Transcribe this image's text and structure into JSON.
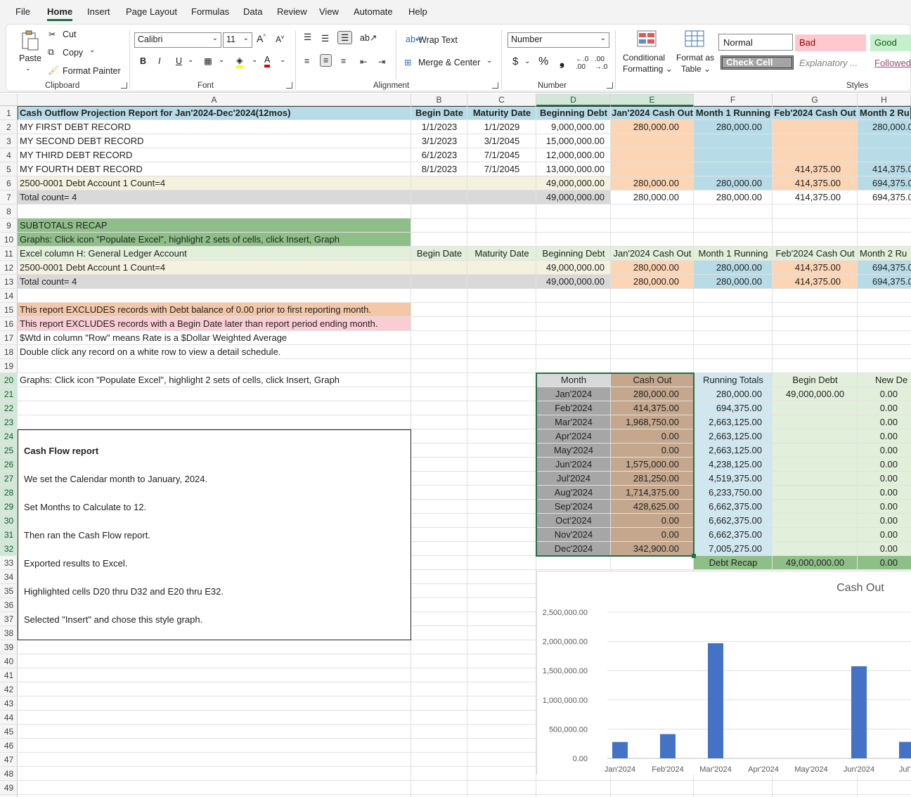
{
  "menu": [
    "File",
    "Home",
    "Insert",
    "Page Layout",
    "Formulas",
    "Data",
    "Review",
    "View",
    "Automate",
    "Help"
  ],
  "ribbon": {
    "clipboard": {
      "paste": "Paste",
      "cut": "Cut",
      "copy": "Copy",
      "format_painter": "Format Painter",
      "label": "Clipboard"
    },
    "font": {
      "name": "Calibri",
      "size": "11",
      "label": "Font",
      "bold": "B",
      "italic": "I",
      "underline": "U"
    },
    "alignment": {
      "wrap": "Wrap Text",
      "merge": "Merge & Center",
      "label": "Alignment"
    },
    "number": {
      "format": "Number",
      "currency": "$",
      "percent": "%",
      "comma": "❟",
      "label": "Number"
    },
    "styles": {
      "conditional": "Conditional",
      "conditional2": "Formatting",
      "format_as": "Format as",
      "format_as2": "Table",
      "normal": "Normal",
      "bad": "Bad",
      "good": "Good",
      "check_cell": "Check Cell",
      "explanatory": "Explanatory ...",
      "followed": "Followed",
      "label": "Styles"
    }
  },
  "columns": [
    "A",
    "B",
    "C",
    "D",
    "E",
    "F",
    "G",
    "H"
  ],
  "rows": [
    "1",
    "2",
    "3",
    "4",
    "5",
    "6",
    "7",
    "8",
    "9",
    "10",
    "11",
    "12",
    "13",
    "14",
    "15",
    "16",
    "17",
    "18",
    "19",
    "20",
    "21",
    "22",
    "23",
    "24",
    "25",
    "26",
    "27",
    "28",
    "29",
    "30",
    "31",
    "32",
    "33",
    "34",
    "35",
    "36",
    "37",
    "38",
    "39",
    "40",
    "41",
    "42",
    "43",
    "44",
    "45",
    "46",
    "47",
    "48",
    "49"
  ],
  "header": {
    "a": "Cash Outflow Projection Report for Jan'2024-Dec'2024(12mos)",
    "b": "Begin Date",
    "c": "Maturity Date",
    "d": "Beginning Debt",
    "e": "Jan'2024 Cash Out",
    "f": "Month 1 Running",
    "g": "Feb'2024 Cash Out",
    "h": "Month 2 Ru"
  },
  "records": [
    {
      "name": "MY FIRST DEBT RECORD",
      "begin": "1/1/2023",
      "maturity": "1/1/2029",
      "debt": "9,000,000.00",
      "e": "280,000.00",
      "f": "280,000.00",
      "g": "",
      "h": "280,000.0"
    },
    {
      "name": "MY SECOND DEBT RECORD",
      "begin": "3/1/2023",
      "maturity": "3/1/2045",
      "debt": "15,000,000.00",
      "e": "",
      "f": "",
      "g": "",
      "h": ""
    },
    {
      "name": "MY THIRD DEBT RECORD",
      "begin": "6/1/2023",
      "maturity": "7/1/2045",
      "debt": "12,000,000.00",
      "e": "",
      "f": "",
      "g": "",
      "h": ""
    },
    {
      "name": "MY FOURTH DEBT RECORD",
      "begin": "8/1/2023",
      "maturity": "7/1/2045",
      "debt": "13,000,000.00",
      "e": "",
      "f": "",
      "g": "414,375.00",
      "h": "414,375.0"
    }
  ],
  "account_row": {
    "name": "2500-0001 Debt Account 1 Count=4",
    "debt": "49,000,000.00",
    "e": "280,000.00",
    "f": "280,000.00",
    "g": "414,375.00",
    "h": "694,375.0"
  },
  "total_row": {
    "name": "Total count= 4",
    "debt": "49,000,000.00",
    "e": "280,000.00",
    "f": "280,000.00",
    "g": "414,375.00",
    "h": "694,375.0"
  },
  "recap": {
    "title": "SUBTOTALS RECAP",
    "graphs": "Graphs: Click icon \"Populate Excel\", highlight 2 sets of cells, click Insert, Graph",
    "gl": "Excel column H: General Ledger Account",
    "b": "Begin Date",
    "c": "Maturity Date",
    "d": "Beginning Debt",
    "e": "Jan'2024 Cash Out",
    "f": "Month 1 Running",
    "g": "Feb'2024 Cash Out",
    "h": "Month 2 Ru"
  },
  "notes": {
    "n15": "This report EXCLUDES records with Debt balance of 0.00 prior to first reporting month.",
    "n16": "This report EXCLUDES records with a Begin Date later than report period ending month.",
    "n17": "$Wtd in column \"Row\" means Rate is a $Dollar Weighted Average",
    "n18": "Double click any record on a white row to view a detail schedule.",
    "n20": "Graphs: Click icon \"Populate Excel\", highlight 2 sets of cells, click Insert, Graph"
  },
  "monthly": {
    "headers": {
      "month": "Month",
      "cash": "Cash Out",
      "running": "Running Totals",
      "begin": "Begin Debt",
      "new": "New De"
    },
    "begin_debt": "49,000,000.00",
    "rows": [
      {
        "m": "Jan'2024",
        "c": "280,000.00",
        "r": "280,000.00",
        "n": "0.00"
      },
      {
        "m": "Feb'2024",
        "c": "414,375.00",
        "r": "694,375.00",
        "n": "0.00"
      },
      {
        "m": "Mar'2024",
        "c": "1,968,750.00",
        "r": "2,663,125.00",
        "n": "0.00"
      },
      {
        "m": "Apr'2024",
        "c": "0.00",
        "r": "2,663,125.00",
        "n": "0.00"
      },
      {
        "m": "May'2024",
        "c": "0.00",
        "r": "2,663,125.00",
        "n": "0.00"
      },
      {
        "m": "Jun'2024",
        "c": "1,575,000.00",
        "r": "4,238,125.00",
        "n": "0.00"
      },
      {
        "m": "Jul'2024",
        "c": "281,250.00",
        "r": "4,519,375.00",
        "n": "0.00"
      },
      {
        "m": "Aug'2024",
        "c": "1,714,375.00",
        "r": "6,233,750.00",
        "n": "0.00"
      },
      {
        "m": "Sep'2024",
        "c": "428,625.00",
        "r": "6,662,375.00",
        "n": "0.00"
      },
      {
        "m": "Oct'2024",
        "c": "0.00",
        "r": "6,662,375.00",
        "n": "0.00"
      },
      {
        "m": "Nov'2024",
        "c": "0.00",
        "r": "6,662,375.00",
        "n": "0.00"
      },
      {
        "m": "Dec'2024",
        "c": "342,900.00",
        "r": "7,005,275.00",
        "n": "0.00"
      }
    ],
    "recap_label": "Debt Recap",
    "recap_value": "49,000,000.00",
    "recap_new": "0.00"
  },
  "notebox": {
    "title": "Cash Flow report",
    "l1": "We set the Calendar month to January, 2024.",
    "l2": "Set Months to Calculate to 12.",
    "l3": "Then ran the Cash Flow report.",
    "l4": "Exported results to Excel.",
    "l5": "Highlighted cells D20 thru D32 and E20 thru E32.",
    "l6": "Selected \"Insert\" and chose this style graph."
  },
  "colors": {
    "blue_fill": "#b7dce8",
    "peach_fill": "#fcd5b4",
    "cream_fill": "#f4f1df",
    "gray_fill": "#d9d9d9",
    "green_fill": "#8fbf88",
    "light_green": "#e2efda",
    "pink_fill": "#f9cdd3",
    "orange_fill": "#f4c7a6",
    "month_gray": "#a6a6a6",
    "cash_tan": "#c4a78d",
    "bar": "#4472c4"
  },
  "chart_data": {
    "type": "bar",
    "title": "Cash Out",
    "categories": [
      "Jan'2024",
      "Feb'2024",
      "Mar'2024",
      "Apr'2024",
      "May'2024",
      "Jun'2024",
      "Jul'2"
    ],
    "values": [
      280000,
      414375,
      1968750,
      0,
      0,
      1575000,
      281250
    ],
    "ylim": [
      0,
      2500000
    ],
    "yticks": [
      "0.00",
      "500,000.00",
      "1,000,000.00",
      "1,500,000.00",
      "2,000,000.00",
      "2,500,000.00"
    ],
    "grid": true,
    "legend": "none"
  }
}
